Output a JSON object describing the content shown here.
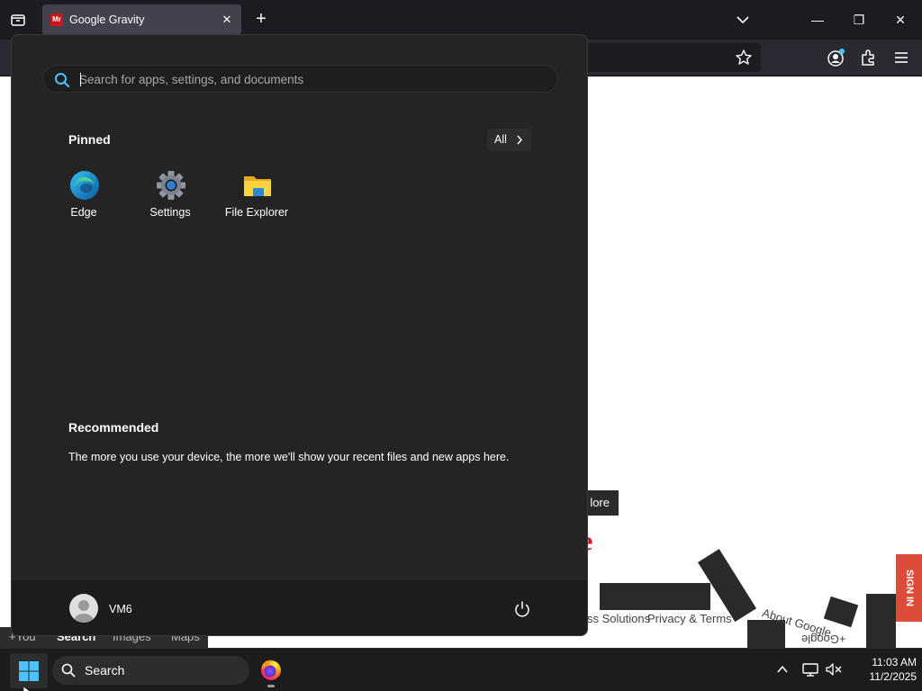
{
  "browser": {
    "tab": {
      "favicon_text": "Mr",
      "title": "Google Gravity",
      "close_glyph": "✕"
    },
    "new_tab_glyph": "+",
    "window_controls": {
      "minimize": "—",
      "restore": "❐",
      "close": "✕"
    },
    "icons": [
      "tab-list-icon",
      "chevron-down-icon",
      "star-icon",
      "account-icon",
      "extensions-icon",
      "menu-icon"
    ]
  },
  "page": {
    "store_chip": "lore",
    "google_letter": "e",
    "footer_links": {
      "business": "ss Solutions",
      "privacy": "Privacy & Terms",
      "about": "About Google",
      "google_plus": "+Google"
    },
    "sign_in": "SIGN IN",
    "bottom_bar": [
      "+You",
      "Search",
      "Images",
      "Maps"
    ],
    "bottom_bar_active": "Search"
  },
  "start_menu": {
    "search_placeholder": "Search for apps, settings, and documents",
    "pinned_heading": "Pinned",
    "all_button": "All",
    "pinned_apps": [
      {
        "label": "Edge",
        "icon": "edge-icon"
      },
      {
        "label": "Settings",
        "icon": "settings-gear-icon"
      },
      {
        "label": "File Explorer",
        "icon": "folder-icon"
      }
    ],
    "recommended_heading": "Recommended",
    "recommended_text": "The more you use your device, the more we'll show your recent files and new apps here.",
    "user_name": "VM6",
    "accent_color": "#4cc2ff"
  },
  "taskbar": {
    "search_label": "Search",
    "time": "11:03 AM",
    "date": "11/2/2025",
    "apps": [
      "firefox-icon"
    ]
  }
}
